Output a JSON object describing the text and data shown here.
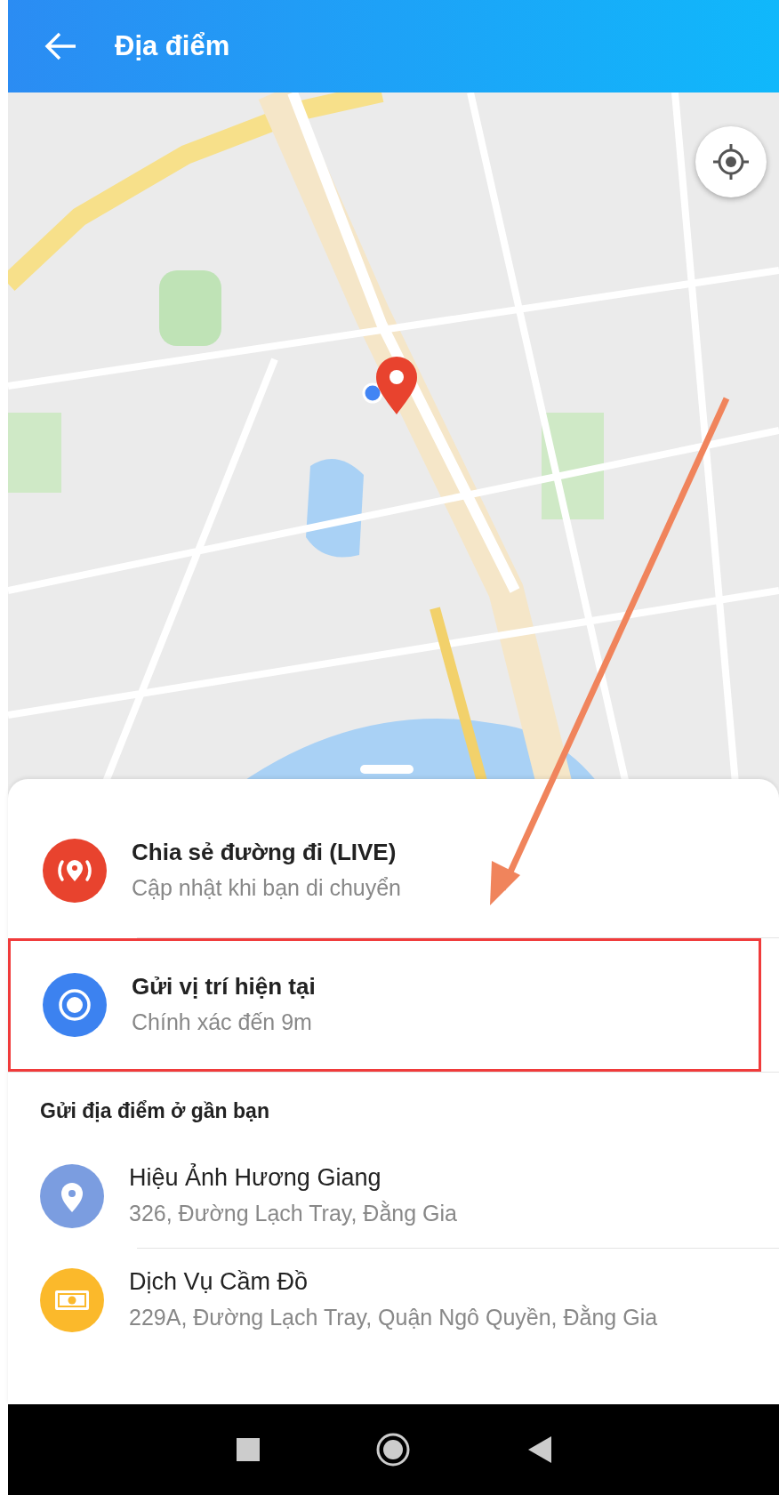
{
  "header": {
    "title": "Địa điểm"
  },
  "options": [
    {
      "kind": "live",
      "title": "Chia sẻ đường đi (LIVE)",
      "subtitle": "Cập nhật khi bạn di chuyển",
      "highlighted": false
    },
    {
      "kind": "current",
      "title": "Gửi vị trí hiện tại",
      "subtitle": "Chính xác đến 9m",
      "highlighted": true
    }
  ],
  "nearby": {
    "heading": "Gửi địa điểm ở gần bạn",
    "places": [
      {
        "kind": "place",
        "name": "Hiệu Ảnh Hương Giang",
        "address": "326, Đường Lạch Tray, Đằng Gia"
      },
      {
        "kind": "pawn",
        "name": "Dịch Vụ Cầm Đồ",
        "address": "229A, Đường Lạch Tray, Quận Ngô Quyền, Đằng Gia"
      }
    ]
  }
}
